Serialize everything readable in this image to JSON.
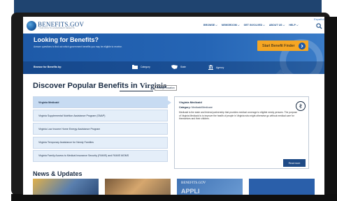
{
  "header": {
    "logo_text": "BENEFITS.GOV",
    "logo_sub": "YOUR PATH TO GOVERNMENT BENEFITS",
    "espanol": "Español",
    "nav": [
      "BROWSE",
      "NEWSROOM",
      "GET INVOLVED",
      "ABOUT US",
      "HELP"
    ]
  },
  "hero": {
    "title": "Looking for Benefits?",
    "subtitle": "Answer questions to find out which government benefits you may be eligible to receive.",
    "start_button": "Start Benefit Finder",
    "browse_label": "Browse for Benefits by:",
    "browse_items": [
      "Category",
      "State",
      "Agency"
    ]
  },
  "popular": {
    "title_prefix": "Discover Popular Benefits in",
    "state": "Virginia",
    "change_location": "Change Location",
    "items": [
      "Virginia Medicaid",
      "Virginia Supplemental Nutrition Assistance Program (SNAP)",
      "Virginia Low Income Home Energy Assistance Program",
      "Virginia Temporary Assistance for Needy Families",
      "Virginia Family Access to Medical Insurance Security (FAMIS) and FAMIS MOMS"
    ],
    "detail": {
      "title": "Virginia Medicaid",
      "category_label": "Category:",
      "category_value": "Medicaid/Medicare",
      "description": "Medicaid is the state and federal partnership that provides medical coverage to eligible needy persons. The purpose of Virginia Medicaid is to improve the health of people in Virginia who might otherwise go without medical care for themselves and their children.",
      "read_more": "Read more"
    }
  },
  "news": {
    "title": "News & Updates",
    "card3_logo": "BENEFITS.GOV",
    "card3_text": "APPLI"
  },
  "colors": {
    "brand_blue": "#1e5aa8",
    "accent_orange": "#f5a623",
    "dark_text": "#1a2c44"
  }
}
